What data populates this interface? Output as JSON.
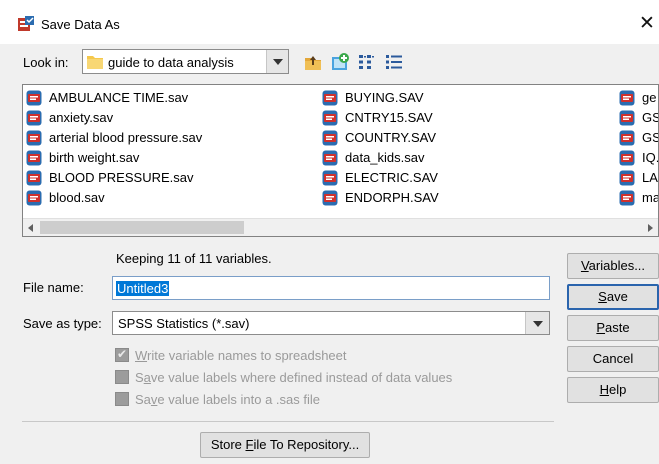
{
  "window": {
    "title": "Save Data As",
    "close_glyph": "✕"
  },
  "lookin": {
    "label": "Look in:",
    "folder": "guide to data analysis"
  },
  "toolbar_icons": [
    "up-folder-icon",
    "new-folder-icon",
    "list-view-icon",
    "details-view-icon"
  ],
  "files": {
    "col1": [
      "AMBULANCE TIME.sav",
      "anxiety.sav",
      "arterial blood pressure.sav",
      "birth weight.sav",
      "BLOOD PRESSURE.sav",
      "blood.sav"
    ],
    "col2": [
      "BUYING.SAV",
      "CNTRY15.SAV",
      "COUNTRY.SAV",
      "data_kids.sav",
      "ELECTRIC.SAV",
      "ENDORPH.SAV"
    ],
    "col3": [
      "ge",
      "GS",
      "GS",
      "IQ.",
      "LA",
      "ma"
    ]
  },
  "status": {
    "keeping": "Keeping 11 of 11 variables."
  },
  "filename": {
    "label": "File name:",
    "value": "Untitled3"
  },
  "savetype": {
    "label": "Save as type:",
    "value": "SPSS Statistics (*.sav)"
  },
  "options": {
    "write_names": {
      "pre": "",
      "u": "W",
      "post": "rite variable names to spreadsheet",
      "checked": true
    },
    "value_labels": {
      "pre": "S",
      "u": "a",
      "post": "ve value labels where defined instead of data values",
      "checked": false
    },
    "sas_labels": {
      "pre": "Sa",
      "u": "v",
      "post": "e value labels into a .sas file",
      "checked": false
    }
  },
  "buttons": {
    "variables": {
      "pre": "",
      "u": "V",
      "post": "ariables..."
    },
    "save": {
      "pre": "",
      "u": "S",
      "post": "ave"
    },
    "paste": {
      "pre": "",
      "u": "P",
      "post": "aste"
    },
    "cancel": {
      "pre": "",
      "u": "",
      "post": "Cancel"
    },
    "help": {
      "pre": "",
      "u": "H",
      "post": "elp"
    },
    "store": {
      "pre": "Store ",
      "u": "F",
      "post": "ile To Repository..."
    }
  },
  "colors": {
    "accent": "#0078d7",
    "default_button_border": "#2a64ad",
    "sav_icon_red": "#d0312d",
    "sav_icon_blue": "#2b6cb0"
  }
}
